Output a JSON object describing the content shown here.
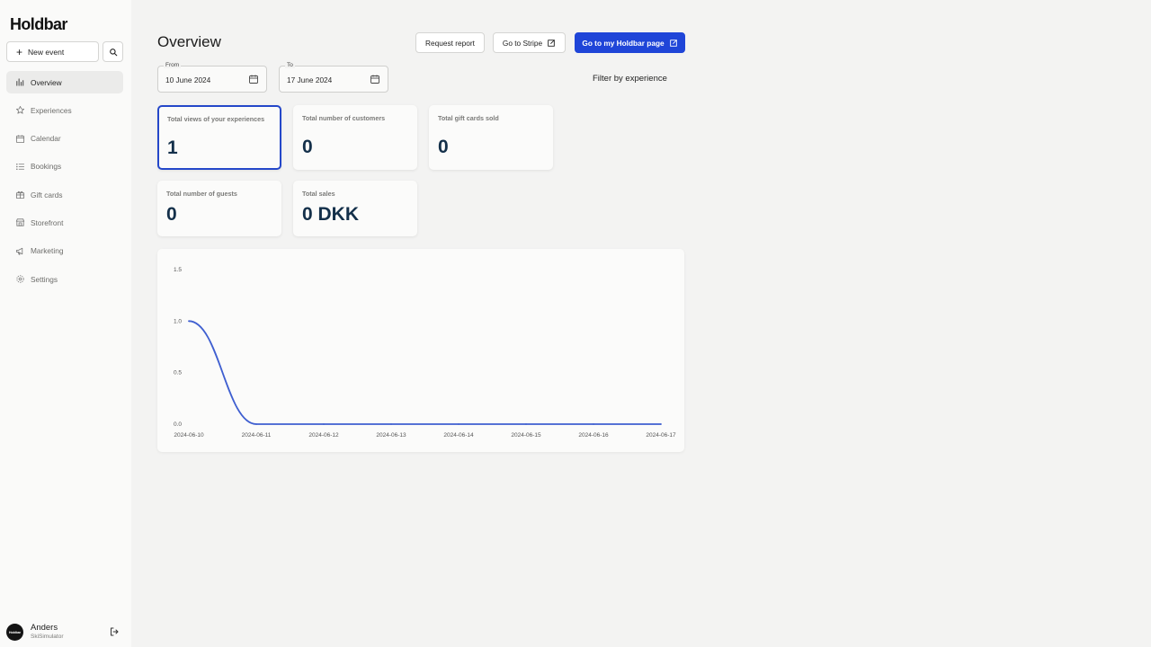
{
  "app": {
    "logo": "Holdbar"
  },
  "sidebar": {
    "new_event_label": "New event",
    "items": [
      {
        "label": "Overview",
        "icon": "bar-chart-icon"
      },
      {
        "label": "Experiences",
        "icon": "star-icon"
      },
      {
        "label": "Calendar",
        "icon": "calendar-icon"
      },
      {
        "label": "Bookings",
        "icon": "list-icon"
      },
      {
        "label": "Gift cards",
        "icon": "gift-icon"
      },
      {
        "label": "Storefront",
        "icon": "store-icon"
      },
      {
        "label": "Marketing",
        "icon": "megaphone-icon"
      },
      {
        "label": "Settings",
        "icon": "gear-icon"
      }
    ],
    "user": {
      "name": "Anders",
      "org": "SkiSimulator",
      "avatar_text": "Holdbar"
    }
  },
  "header": {
    "title": "Overview",
    "request_report": "Request report",
    "go_to_stripe": "Go to Stripe",
    "go_to_page": "Go to my Holdbar page"
  },
  "filters": {
    "from_label": "From",
    "from_value": "10 June 2024",
    "to_label": "To",
    "to_value": "17 June 2024",
    "filter_by": "Filter by experience"
  },
  "stats": [
    {
      "label": "Total views of your experiences",
      "value": "1"
    },
    {
      "label": "Total number of customers",
      "value": "0"
    },
    {
      "label": "Total gift cards sold",
      "value": "0"
    },
    {
      "label": "Total number of guests",
      "value": "0"
    },
    {
      "label": "Total sales",
      "value": "0 DKK"
    }
  ],
  "colors": {
    "accent": "#1f45d8",
    "line": "#3f5fd0",
    "selected_border": "#2447c9"
  },
  "chart_data": {
    "type": "line",
    "x": [
      "2024-06-10",
      "2024-06-11",
      "2024-06-12",
      "2024-06-13",
      "2024-06-14",
      "2024-06-15",
      "2024-06-16",
      "2024-06-17"
    ],
    "series": [
      {
        "values": [
          1,
          0,
          0,
          0,
          0,
          0,
          0,
          0
        ]
      }
    ],
    "yticks": [
      "0.0",
      "0.5",
      "1.0",
      "1.5"
    ],
    "ylim": [
      0,
      1.5
    ],
    "grid": false,
    "curve": "smooth"
  }
}
